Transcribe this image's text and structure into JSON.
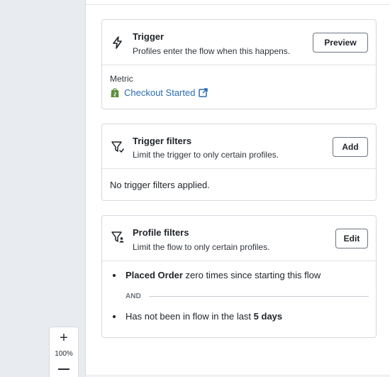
{
  "zoom": {
    "plus": "+",
    "level": "100%",
    "minus": "−"
  },
  "trigger": {
    "title": "Trigger",
    "subtitle": "Profiles enter the flow when this happens.",
    "button": "Preview",
    "metric_label": "Metric",
    "metric_value": "Checkout Started",
    "icons": [
      "lightning-icon",
      "shopify-bag-icon",
      "external-link-icon"
    ]
  },
  "trigger_filters": {
    "title": "Trigger filters",
    "subtitle": "Limit the trigger to only certain profiles.",
    "button": "Add",
    "empty_text": "No trigger filters applied.",
    "icons": [
      "filter-icon"
    ]
  },
  "profile_filters": {
    "title": "Profile filters",
    "subtitle": "Limit the flow to only certain profiles.",
    "button": "Edit",
    "conditions": [
      {
        "bold": "Placed Order",
        "rest": " zero times since starting this flow"
      },
      {
        "lead": "Has not been in flow in the last ",
        "bold": "5 days"
      }
    ],
    "separator": "AND",
    "icons": [
      "profile-filter-icon"
    ]
  },
  "colors": {
    "link": "#2b6cb0",
    "shopify_green": "#5e8e3e",
    "canvas": "#e8ecf1"
  }
}
